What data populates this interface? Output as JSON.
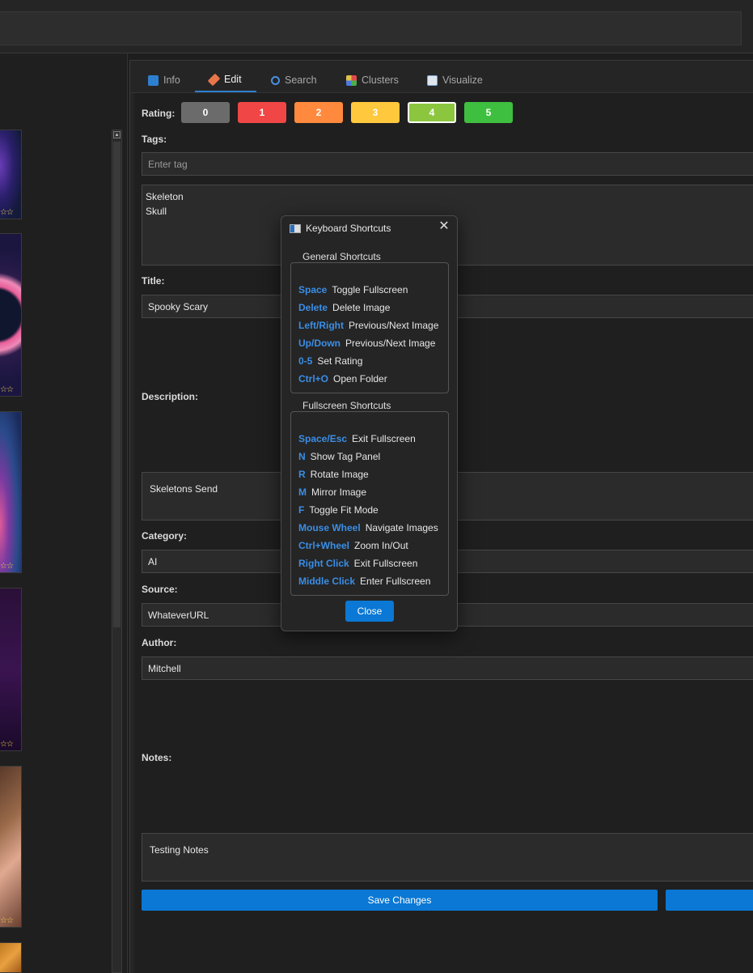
{
  "tabs": [
    {
      "label": "Info",
      "icon": "info-icon",
      "color": "#2d7fd0"
    },
    {
      "label": "Edit",
      "icon": "pencil-icon",
      "color": "#e8764a"
    },
    {
      "label": "Search",
      "icon": "magnifier-icon",
      "color": "#4a8fe0"
    },
    {
      "label": "Clusters",
      "icon": "color-grid-icon",
      "color": "#c64a8a"
    },
    {
      "label": "Visualize",
      "icon": "chart-icon",
      "color": "#7aa6d6"
    }
  ],
  "rating": {
    "label": "Rating:",
    "buttons": [
      {
        "label": "0",
        "color": "#6b6b6b"
      },
      {
        "label": "1",
        "color": "#f04646"
      },
      {
        "label": "2",
        "color": "#ff8a3d"
      },
      {
        "label": "3",
        "color": "#ffc83d"
      },
      {
        "label": "4",
        "color": "#8cc63f",
        "selected": true
      },
      {
        "label": "5",
        "color": "#3fbf3f"
      }
    ]
  },
  "form": {
    "tags_label": "Tags:",
    "tag_placeholder": "Enter tag",
    "tags": "Skeleton\nSkull",
    "title_label": "Title:",
    "title_value": "Spooky Scary",
    "description_label": "Description:",
    "description_value": "Skeletons Send",
    "category_label": "Category:",
    "category_value": "AI",
    "source_label": "Source:",
    "source_value": "WhateverURL",
    "author_label": "Author:",
    "author_value": "Mitchell",
    "notes_label": "Notes:",
    "notes_value": "Testing Notes",
    "save_label": "Save Changes"
  },
  "thumbnails": {
    "stars": "☆☆"
  },
  "dialog": {
    "title": "Keyboard Shortcuts",
    "general_title": "General Shortcuts",
    "general": [
      {
        "key": "Space",
        "desc": "Toggle Fullscreen"
      },
      {
        "key": "Delete",
        "desc": "Delete Image"
      },
      {
        "key": "Left/Right",
        "desc": "Previous/Next Image"
      },
      {
        "key": "Up/Down",
        "desc": "Previous/Next Image"
      },
      {
        "key": "0-5",
        "desc": "Set Rating"
      },
      {
        "key": "Ctrl+O",
        "desc": "Open Folder"
      }
    ],
    "fullscreen_title": "Fullscreen Shortcuts",
    "fullscreen": [
      {
        "key": "Space/Esc",
        "desc": "Exit Fullscreen"
      },
      {
        "key": "N",
        "desc": "Show Tag Panel"
      },
      {
        "key": "R",
        "desc": "Rotate Image"
      },
      {
        "key": "M",
        "desc": "Mirror Image"
      },
      {
        "key": "F",
        "desc": "Toggle Fit Mode"
      },
      {
        "key": "Mouse Wheel",
        "desc": "Navigate Images"
      },
      {
        "key": "Ctrl+Wheel",
        "desc": "Zoom In/Out"
      },
      {
        "key": "Right Click",
        "desc": "Exit Fullscreen"
      },
      {
        "key": "Middle Click",
        "desc": "Enter Fullscreen"
      }
    ],
    "close_label": "Close"
  }
}
